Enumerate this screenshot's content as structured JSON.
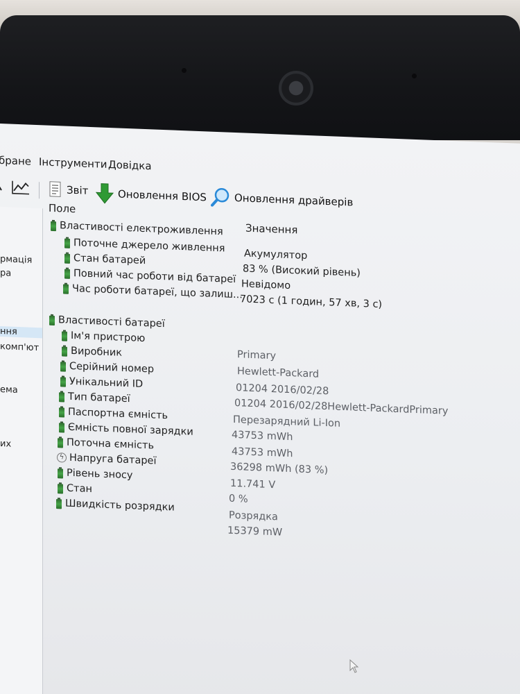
{
  "menu": {
    "items": [
      "бране",
      "Інструменти",
      "Довідка"
    ]
  },
  "toolbar": {
    "report_label": "Звіт",
    "bios_label": "Оновлення BIOS",
    "drivers_label": "Оновлення драйверів"
  },
  "left_panel": {
    "items": [
      "рмація",
      "ра",
      "ння",
      "комп'ют",
      "ема",
      "их"
    ]
  },
  "grid": {
    "col_field": "Поле",
    "col_value": "Значення",
    "power_section": "Властивості електроживлення",
    "power_rows": [
      {
        "field": "Поточне джерело живлення",
        "value": "Акумулятор"
      },
      {
        "field": "Стан батарей",
        "value": "83 % (Високий рівень)"
      },
      {
        "field": "Повний час роботи від батареї",
        "value": "Невідомо"
      },
      {
        "field": "Час роботи батареї, що залиш...",
        "value": "7023 с (1 годин, 57 хв, 3 с)"
      }
    ],
    "battery_section": "Властивості батареї",
    "battery_rows": [
      {
        "field": "Ім'я пристрою",
        "value": "Primary"
      },
      {
        "field": "Виробник",
        "value": "Hewlett-Packard"
      },
      {
        "field": "Серійний номер",
        "value": "01204 2016/02/28"
      },
      {
        "field": "Унікальний ID",
        "value": "01204 2016/02/28Hewlett-PackardPrimary"
      },
      {
        "field": "Тип батареї",
        "value": "Перезарядний Li-Ion"
      },
      {
        "field": "Паспортна ємність",
        "value": "43753 mWh"
      },
      {
        "field": "Ємність повної зарядки",
        "value": "43753 mWh"
      },
      {
        "field": "Поточна ємність",
        "value": "36298 mWh  (83 %)"
      },
      {
        "field": "Напруга батареї",
        "value": "11.741 V"
      },
      {
        "field": "Рівень зносу",
        "value": "0 %"
      },
      {
        "field": "Стан",
        "value": "Розрядка"
      },
      {
        "field": "Швидкість розрядки",
        "value": "15379 mW"
      }
    ]
  },
  "colors": {
    "battery_green": "#46a548",
    "bios_arrow": "#2f9a34",
    "magnifier": "#2a8ad8"
  }
}
